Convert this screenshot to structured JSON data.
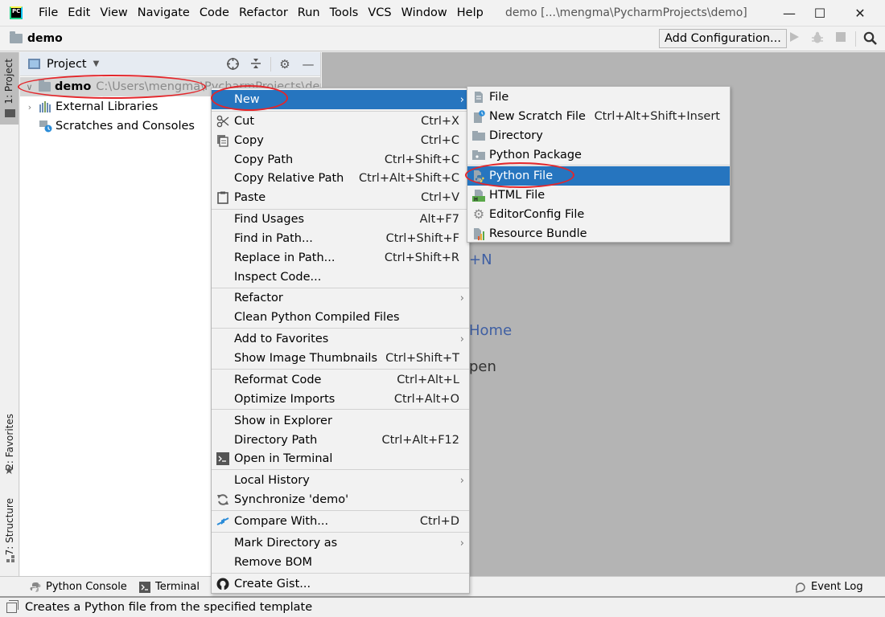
{
  "app": {
    "logo_text": "PC",
    "window_title": "demo [...\\mengma\\PycharmProjects\\demo]",
    "window_controls": {
      "minimize": "—",
      "maximize": "☐",
      "close": "✕"
    }
  },
  "menubar": {
    "items": [
      {
        "label": "File"
      },
      {
        "label": "Edit"
      },
      {
        "label": "View"
      },
      {
        "label": "Navigate"
      },
      {
        "label": "Code"
      },
      {
        "label": "Refactor"
      },
      {
        "label": "Run"
      },
      {
        "label": "Tools"
      },
      {
        "label": "VCS"
      },
      {
        "label": "Window"
      },
      {
        "label": "Help"
      }
    ]
  },
  "navbar": {
    "project": "demo",
    "add_configuration": "Add Configuration...",
    "icons": [
      "run-icon",
      "debug-icon",
      "stop-icon",
      "search-icon"
    ]
  },
  "left_strip": {
    "project_tab": "1: Project",
    "favorites_tab": "2: Favorites",
    "structure_tab": "7: Structure"
  },
  "project_panel": {
    "title": "Project",
    "tree": [
      {
        "label": "demo",
        "path": "C:\\Users\\mengma\\PycharmProjects\\demo",
        "expanded": true,
        "selected": true
      },
      {
        "label": "External Libraries",
        "expanded": false
      },
      {
        "label": "Scratches and Consoles"
      }
    ]
  },
  "editor": {
    "hints": [
      "+N",
      "Home",
      "pen"
    ]
  },
  "context_menu": {
    "items": [
      {
        "label": "New",
        "shortcut": "",
        "submenu": true,
        "active": true
      },
      {
        "label": "Cut",
        "shortcut": "Ctrl+X",
        "icon": "scissors-icon"
      },
      {
        "label": "Copy",
        "shortcut": "Ctrl+C",
        "icon": "copy-icon"
      },
      {
        "label": "Copy Path",
        "shortcut": "Ctrl+Shift+C"
      },
      {
        "label": "Copy Relative Path",
        "shortcut": "Ctrl+Alt+Shift+C"
      },
      {
        "label": "Paste",
        "shortcut": "Ctrl+V",
        "icon": "paste-icon"
      },
      {
        "label": "Find Usages",
        "shortcut": "Alt+F7"
      },
      {
        "label": "Find in Path...",
        "shortcut": "Ctrl+Shift+F"
      },
      {
        "label": "Replace in Path...",
        "shortcut": "Ctrl+Shift+R"
      },
      {
        "label": "Inspect Code...",
        "shortcut": ""
      },
      {
        "label": "Refactor",
        "shortcut": "",
        "submenu": true
      },
      {
        "label": "Clean Python Compiled Files",
        "shortcut": ""
      },
      {
        "label": "Add to Favorites",
        "shortcut": "",
        "submenu": true
      },
      {
        "label": "Show Image Thumbnails",
        "shortcut": "Ctrl+Shift+T"
      },
      {
        "label": "Reformat Code",
        "shortcut": "Ctrl+Alt+L"
      },
      {
        "label": "Optimize Imports",
        "shortcut": "Ctrl+Alt+O"
      },
      {
        "label": "Show in Explorer",
        "shortcut": ""
      },
      {
        "label": "Directory Path",
        "shortcut": "Ctrl+Alt+F12"
      },
      {
        "label": "Open in Terminal",
        "shortcut": "",
        "icon": "terminal-icon"
      },
      {
        "label": "Local History",
        "shortcut": "",
        "submenu": true
      },
      {
        "label": "Synchronize 'demo'",
        "shortcut": "",
        "icon": "sync-icon"
      },
      {
        "label": "Compare With...",
        "shortcut": "Ctrl+D",
        "icon": "compare-icon"
      },
      {
        "label": "Mark Directory as",
        "shortcut": "",
        "submenu": true
      },
      {
        "label": "Remove BOM",
        "shortcut": ""
      },
      {
        "label": "Create Gist...",
        "shortcut": "",
        "icon": "github-icon"
      }
    ],
    "submenu_arrow": "›"
  },
  "new_submenu": {
    "items": [
      {
        "label": "File",
        "shortcut": ""
      },
      {
        "label": "New Scratch File",
        "shortcut": "Ctrl+Alt+Shift+Insert"
      },
      {
        "label": "Directory",
        "shortcut": ""
      },
      {
        "label": "Python Package",
        "shortcut": ""
      },
      {
        "label": "Python File",
        "shortcut": "",
        "active": true
      },
      {
        "label": "HTML File",
        "shortcut": ""
      },
      {
        "label": "EditorConfig File",
        "shortcut": ""
      },
      {
        "label": "Resource Bundle",
        "shortcut": ""
      }
    ]
  },
  "bottom_tools": {
    "python_console": "Python Console",
    "terminal": "Terminal",
    "event_log": "Event Log"
  },
  "statusbar": {
    "text": "Creates a Python file from the specified template"
  },
  "colors": {
    "selection_blue": "#2675bf",
    "annotation_red": "#e3262b",
    "editor_bg": "#b4b4b4"
  }
}
